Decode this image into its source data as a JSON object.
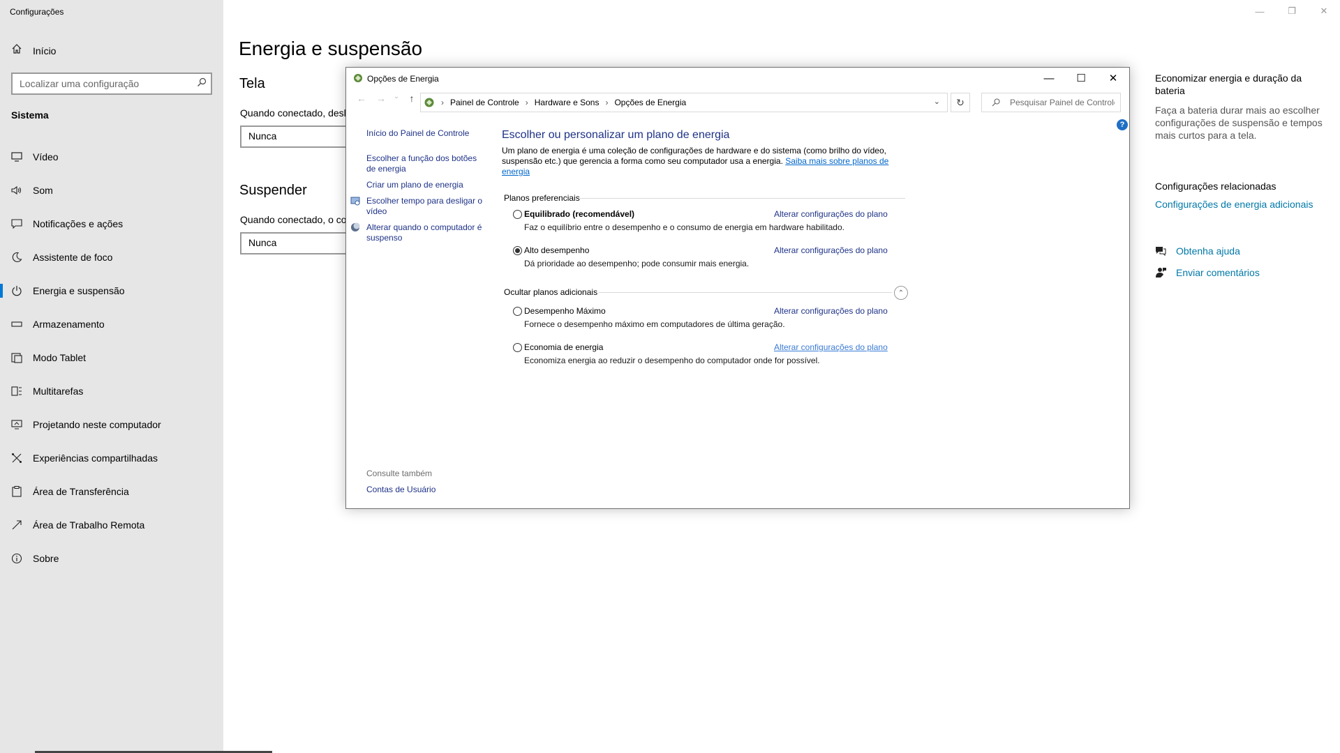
{
  "settings": {
    "app_title": "Configurações",
    "home_label": "Início",
    "search_placeholder": "Localizar uma configuração",
    "section_label": "Sistema",
    "nav_items": [
      {
        "label": "Vídeo"
      },
      {
        "label": "Som"
      },
      {
        "label": "Notificações e ações"
      },
      {
        "label": "Assistente de foco"
      },
      {
        "label": "Energia e suspensão"
      },
      {
        "label": "Armazenamento"
      },
      {
        "label": "Modo Tablet"
      },
      {
        "label": "Multitarefas"
      },
      {
        "label": "Projetando neste computador"
      },
      {
        "label": "Experiências compartilhadas"
      },
      {
        "label": "Área de Transferência"
      },
      {
        "label": "Área de Trabalho Remota"
      },
      {
        "label": "Sobre"
      }
    ],
    "active_nav": "Energia e suspensão",
    "page_title": "Energia e suspensão",
    "screen_heading": "Tela",
    "screen_label": "Quando conectado, desli",
    "screen_value": "Nunca",
    "sleep_heading": "Suspender",
    "sleep_label": "Quando conectado, o co",
    "sleep_value": "Nunca",
    "right": {
      "tip_title": "Economizar energia e duração da bateria",
      "tip_text": "Faça a bateria durar mais ao escolher configurações de suspensão e tempos mais curtos para a tela.",
      "related_title": "Configurações relacionadas",
      "related_link": "Configurações de energia adicionais",
      "help_link": "Obtenha ajuda",
      "feedback_link": "Enviar comentários"
    }
  },
  "control_panel": {
    "title": "Opções de Energia",
    "breadcrumb": [
      "Painel de Controle",
      "Hardware e Sons",
      "Opções de Energia"
    ],
    "search_placeholder": "Pesquisar Painel de Controle",
    "left_links": {
      "home": "Início do Painel de Controle",
      "buttons": "Escolher a função dos botões de energia",
      "create": "Criar um plano de energia",
      "display": "Escolher tempo para desligar o vídeo",
      "sleep": "Alterar quando o computador é suspenso"
    },
    "see_also": "Consulte também",
    "user_accounts": "Contas de Usuário",
    "heading": "Escolher ou personalizar um plano de energia",
    "description": "Um plano de energia é uma coleção de configurações de hardware e do sistema (como brilho do vídeo, suspensão etc.) que gerencia a forma como seu computador usa a energia.",
    "learn_more": "Saiba mais sobre planos de energia",
    "preferred_label": "Planos preferenciais",
    "hidden_label": "Ocultar planos adicionais",
    "change_label": "Alterar configurações do plano",
    "plans": [
      {
        "name": "Equilibrado (recomendável)",
        "desc": "Faz o equilíbrio entre o desempenho e o consumo de energia em hardware habilitado.",
        "selected": false
      },
      {
        "name": "Alto desempenho",
        "desc": "Dá prioridade ao desempenho; pode consumir mais energia.",
        "selected": true
      },
      {
        "name": "Desempenho Máximo",
        "desc": "Fornece o desempenho máximo em computadores de última geração.",
        "selected": false
      },
      {
        "name": "Economia de energia",
        "desc": "Economiza energia ao reduzir o desempenho do computador onde for possível.",
        "selected": false
      }
    ]
  }
}
